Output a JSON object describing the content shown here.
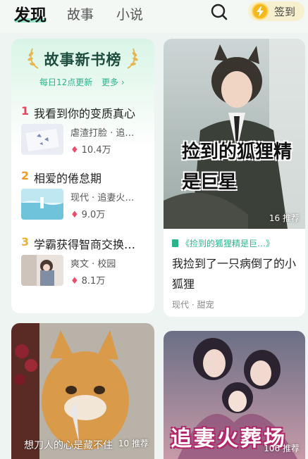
{
  "header": {
    "tabs": [
      {
        "label": "发现",
        "active": true
      },
      {
        "label": "故事",
        "active": false
      },
      {
        "label": "小说",
        "active": false
      }
    ],
    "search_icon": "search-icon",
    "checkin_label": "签到",
    "checkin_icon": "lightning-coin-icon"
  },
  "ranking": {
    "title": "故事新书榜",
    "subtitle": "每日12点更新",
    "more_label": "更多 ›",
    "items": [
      {
        "rank": "1",
        "rank_color": "#e8455a",
        "name": "我看到你的变质真心",
        "tags": "虐渣打脸 · 追…",
        "heat": "10.4万"
      },
      {
        "rank": "2",
        "rank_color": "#f09a2a",
        "name": "相爱的倦怠期",
        "tags": "现代 · 追妻火…",
        "heat": "9.0万"
      },
      {
        "rank": "3",
        "rank_color": "#e9b237",
        "name": "学霸获得智商交换…",
        "tags": "爽文 · 校园",
        "heat": "8.1万"
      }
    ],
    "pager_count": 5,
    "pager_active": 0
  },
  "feed": [
    {
      "cover_title": "捡到的狐狸精是巨星",
      "cover_title_line1": "捡到的狐狸精",
      "cover_title_line2": "是巨星",
      "recommend": "16 推荐",
      "source": "《捡到的狐狸精是巨…》",
      "title": "我捡到了一只病倒了的小狐狸",
      "tags": "现代 · 甜宠"
    },
    {
      "caption": "想刀人的心是藏不住",
      "recommend": "10 推荐"
    },
    {
      "cover_title": "追妻火葬场",
      "recommend": "106 推荐"
    }
  ],
  "colors": {
    "accent": "#2fc297",
    "flame": "#ef4b6c",
    "background": "#eef4f1"
  }
}
